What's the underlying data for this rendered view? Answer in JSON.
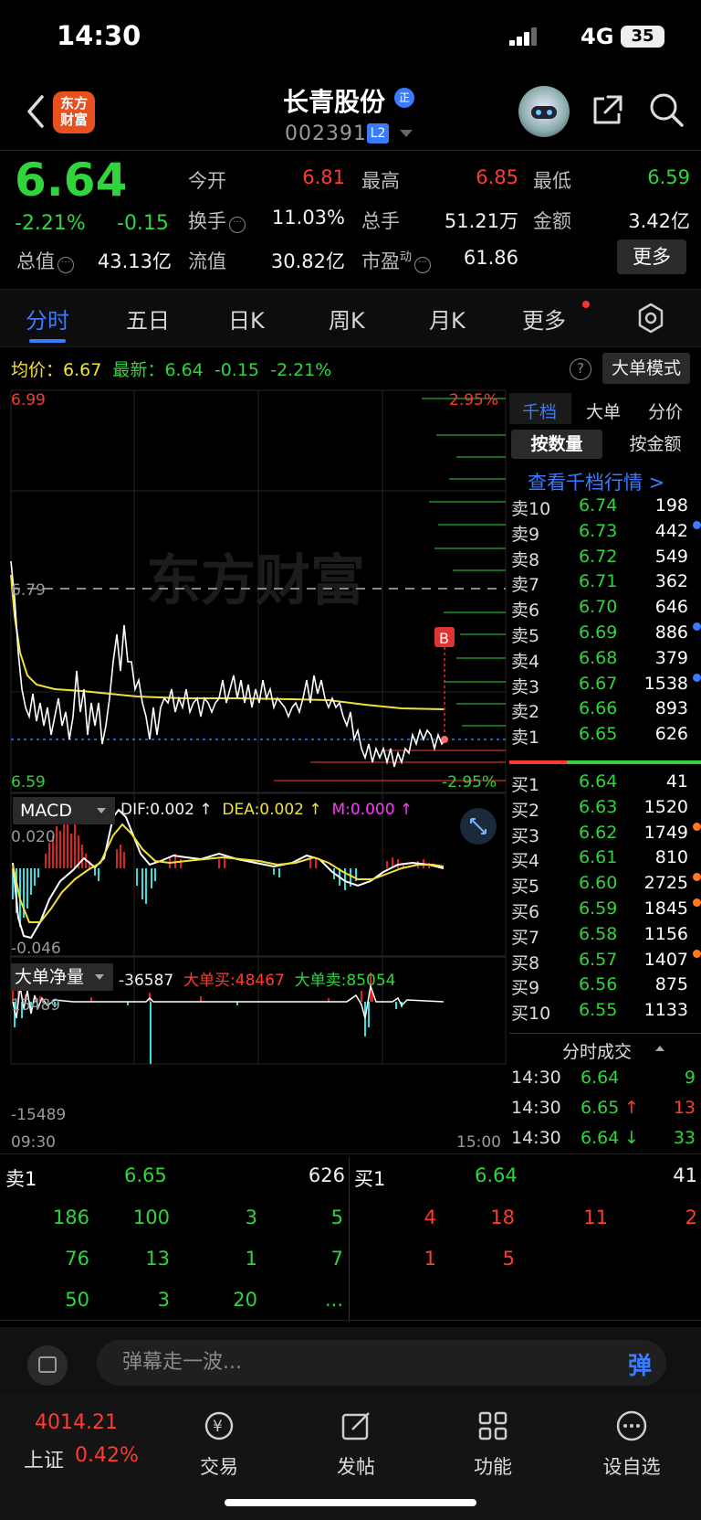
{
  "status_bar": {
    "time": "14:30",
    "network": "4G",
    "battery": "35"
  },
  "header": {
    "app_logo_text": "东方\n财富",
    "stock_name": "长青股份",
    "name_badge": "正",
    "stock_code": "002391",
    "level_badge": "L2"
  },
  "quote": {
    "last_price": "6.64",
    "change_pct": "-2.21%",
    "change_amt": "-0.15",
    "open_label": "今开",
    "open": "6.81",
    "high_label": "最高",
    "high": "6.85",
    "low_label": "最低",
    "low": "6.59",
    "turnover_label": "换手",
    "turnover": "11.03%",
    "volume_label": "总手",
    "volume": "51.21万",
    "amount_label": "金额",
    "amount": "3.42亿",
    "mktcap_label": "总值",
    "mktcap": "43.13亿",
    "float_label": "流值",
    "float_cap": "30.82亿",
    "pe_label": "市盈",
    "pe_sup": "动",
    "pe": "61.86",
    "more_button": "更多"
  },
  "tabs": [
    "分时",
    "五日",
    "日K",
    "周K",
    "月K",
    "更多"
  ],
  "info_row": {
    "avg_label": "均价：",
    "avg": "6.67",
    "latest_label": "最新：",
    "latest": "6.64",
    "latest_chg": "-0.15",
    "latest_pct": "-2.21%",
    "help": "?",
    "mode_button": "大单模式"
  },
  "chart": {
    "y_top": "6.99",
    "y_mid": "6.79",
    "y_bottom": "6.59",
    "pct_top": "2.95%",
    "pct_bottom": "-2.95%",
    "watermark": "东方财富",
    "buy_marker": "B",
    "macd_label": "MACD",
    "dif": "DIF:0.002 ↑",
    "dea": "DEA:0.002 ↑",
    "m": "M:0.000 ↑",
    "macd_top": "0.020",
    "macd_bottom": "-0.046",
    "bignet_label": "大单净量",
    "bignet_value": "-36587",
    "bignet_buy": "大单买:48467",
    "bignet_sell": "大单卖:85054",
    "bignet_top": "15489",
    "bignet_bottom": "-15489",
    "time_start": "09:30",
    "time_end": "15:00"
  },
  "order_panel": {
    "tabs": [
      "千档",
      "大单",
      "分价"
    ],
    "subtabs": [
      "按数量",
      "按金额"
    ],
    "link": "查看千档行情 >",
    "asks": [
      {
        "label": "卖10",
        "price": "6.74",
        "vol": "198",
        "dot": ""
      },
      {
        "label": "卖9",
        "price": "6.73",
        "vol": "442",
        "dot": "#3a7bff"
      },
      {
        "label": "卖8",
        "price": "6.72",
        "vol": "549",
        "dot": ""
      },
      {
        "label": "卖7",
        "price": "6.71",
        "vol": "362",
        "dot": ""
      },
      {
        "label": "卖6",
        "price": "6.70",
        "vol": "646",
        "dot": ""
      },
      {
        "label": "卖5",
        "price": "6.69",
        "vol": "886",
        "dot": "#3a7bff"
      },
      {
        "label": "卖4",
        "price": "6.68",
        "vol": "379",
        "dot": ""
      },
      {
        "label": "卖3",
        "price": "6.67",
        "vol": "1538",
        "dot": "#3a7bff"
      },
      {
        "label": "卖2",
        "price": "6.66",
        "vol": "893",
        "dot": ""
      },
      {
        "label": "卖1",
        "price": "6.65",
        "vol": "626",
        "dot": ""
      }
    ],
    "bids": [
      {
        "label": "买1",
        "price": "6.64",
        "vol": "41",
        "dot": ""
      },
      {
        "label": "买2",
        "price": "6.63",
        "vol": "1520",
        "dot": ""
      },
      {
        "label": "买3",
        "price": "6.62",
        "vol": "1749",
        "dot": "#ff7a1a"
      },
      {
        "label": "买4",
        "price": "6.61",
        "vol": "810",
        "dot": ""
      },
      {
        "label": "买5",
        "price": "6.60",
        "vol": "2725",
        "dot": "#ff7a1a"
      },
      {
        "label": "买6",
        "price": "6.59",
        "vol": "1845",
        "dot": "#ff7a1a"
      },
      {
        "label": "买7",
        "price": "6.58",
        "vol": "1156",
        "dot": ""
      },
      {
        "label": "买8",
        "price": "6.57",
        "vol": "1407",
        "dot": "#ff7a1a"
      },
      {
        "label": "买9",
        "price": "6.56",
        "vol": "875",
        "dot": ""
      },
      {
        "label": "买10",
        "price": "6.55",
        "vol": "1133",
        "dot": ""
      }
    ],
    "trades_header": "分时成交",
    "trades": [
      {
        "time": "14:30",
        "price": "6.64",
        "arrow": "",
        "vol": "9",
        "vol_color": "#2fd53b"
      },
      {
        "time": "14:30",
        "price": "6.65",
        "arrow": "↑",
        "vol": "13",
        "vol_color": "#ff3b30"
      },
      {
        "time": "14:30",
        "price": "6.64",
        "arrow": "↓",
        "vol": "33",
        "vol_color": "#2fd53b"
      }
    ]
  },
  "queue": {
    "sell1_label": "卖1",
    "sell1_price": "6.65",
    "sell1_vol": "626",
    "buy1_label": "买1",
    "buy1_price": "6.64",
    "buy1_vol": "41",
    "sell_orders": [
      [
        "186",
        "100",
        "3",
        "5"
      ],
      [
        "76",
        "13",
        "1",
        "7"
      ],
      [
        "50",
        "3",
        "20",
        "..."
      ]
    ],
    "buy_orders": [
      [
        "4",
        "18",
        "11",
        "2"
      ],
      [
        "1",
        "5"
      ]
    ]
  },
  "comment_bar": {
    "placeholder": "弹幕走一波...",
    "send": "弹"
  },
  "bottom_nav": {
    "index_value": "4014.21",
    "index_name": "上证",
    "index_pct": "0.42%",
    "items": [
      "交易",
      "发帖",
      "功能",
      "设自选"
    ]
  }
}
